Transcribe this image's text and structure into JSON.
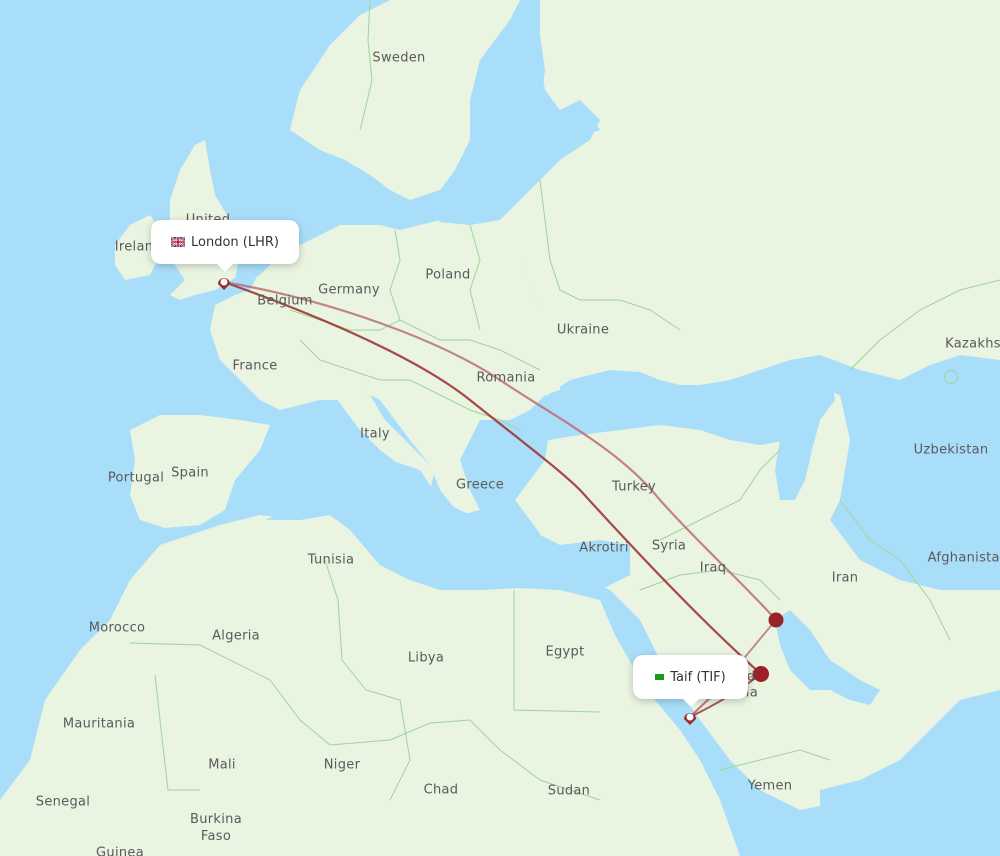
{
  "map": {
    "colors": {
      "water": "#a9defa",
      "land": "#e9f4e1",
      "land_dark": "#dcecd2",
      "border": "#9fd49a",
      "route": "#9b2a2a",
      "route_light": "#b86868",
      "stop_marker": "#9b2228"
    },
    "origin": {
      "city": "London",
      "code": "LHR",
      "label": "London (LHR)",
      "flag": "uk-flag"
    },
    "destination": {
      "city": "Taif",
      "code": "TIF",
      "label": "Taif (TIF)",
      "flag": "saudi-flag"
    },
    "country_labels": [
      {
        "id": "sweden",
        "text": "Sweden"
      },
      {
        "id": "united",
        "text": "United"
      },
      {
        "id": "ireland",
        "text": "Irelan"
      },
      {
        "id": "belgium",
        "text": "Belgium"
      },
      {
        "id": "germany",
        "text": "Germany"
      },
      {
        "id": "poland",
        "text": "Poland"
      },
      {
        "id": "ukraine",
        "text": "Ukraine"
      },
      {
        "id": "kazakhstan",
        "text": "Kazakhs"
      },
      {
        "id": "france",
        "text": "France"
      },
      {
        "id": "romania",
        "text": "Romania"
      },
      {
        "id": "italy",
        "text": "Italy"
      },
      {
        "id": "portugal",
        "text": "Portugal"
      },
      {
        "id": "spain",
        "text": "Spain"
      },
      {
        "id": "greece",
        "text": "Greece"
      },
      {
        "id": "turkey",
        "text": "Turkey"
      },
      {
        "id": "uzbekistan",
        "text": "Uzbekistan"
      },
      {
        "id": "tunisia",
        "text": "Tunisia"
      },
      {
        "id": "akrotiri",
        "text": "Akrotiri"
      },
      {
        "id": "syria",
        "text": "Syria"
      },
      {
        "id": "afghanistan",
        "text": "Afghanistan"
      },
      {
        "id": "iraq",
        "text": "Iraq"
      },
      {
        "id": "iran",
        "text": "Iran"
      },
      {
        "id": "morocco",
        "text": "Morocco"
      },
      {
        "id": "algeria",
        "text": "Algeria"
      },
      {
        "id": "libya",
        "text": "Libya"
      },
      {
        "id": "egypt",
        "text": "Egypt"
      },
      {
        "id": "saudi-arabia-1",
        "text": "d"
      },
      {
        "id": "saudi-arabia-2",
        "text": "ia"
      },
      {
        "id": "mauritania",
        "text": "Mauritania"
      },
      {
        "id": "mali",
        "text": "Mali"
      },
      {
        "id": "niger",
        "text": "Niger"
      },
      {
        "id": "yemen",
        "text": "Yemen"
      },
      {
        "id": "chad",
        "text": "Chad"
      },
      {
        "id": "sudan",
        "text": "Sudan"
      },
      {
        "id": "senegal",
        "text": "Senegal"
      },
      {
        "id": "burkina-faso",
        "text": "Burkina\nFaso"
      },
      {
        "id": "guinea",
        "text": "Guinea"
      }
    ],
    "routes": [
      {
        "id": "route-via-riyadh",
        "from": "LHR",
        "via": "Riyadh stop",
        "to": "TIF"
      },
      {
        "id": "route-via-kuwait",
        "from": "LHR",
        "via": "Kuwait stop",
        "to": "TIF"
      }
    ]
  }
}
